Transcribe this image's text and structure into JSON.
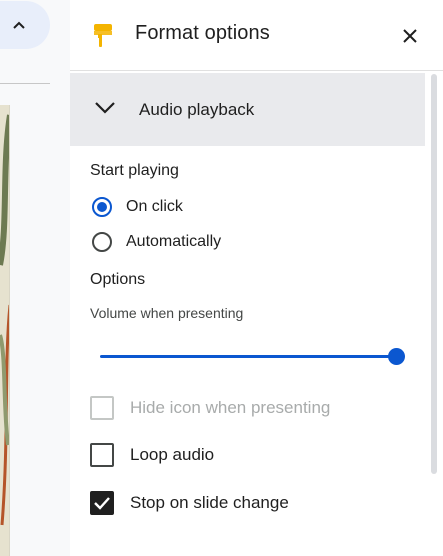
{
  "panel": {
    "title": "Format options",
    "icon": "paint-roller-icon",
    "close_icon": "close-icon"
  },
  "left_strip": {
    "collapse_icon": "chevron-up-icon"
  },
  "section": {
    "title": "Audio playback",
    "expanded": true,
    "icon": "chevron-down-icon"
  },
  "start_playing": {
    "heading": "Start playing",
    "options": [
      {
        "label": "On click",
        "selected": true
      },
      {
        "label": "Automatically",
        "selected": false
      }
    ]
  },
  "options": {
    "heading": "Options",
    "volume_label": "Volume when presenting",
    "volume_level": 1.0,
    "checkboxes": [
      {
        "label": "Hide icon when presenting",
        "checked": false,
        "disabled": true
      },
      {
        "label": "Loop audio",
        "checked": false,
        "disabled": false
      },
      {
        "label": "Stop on slide change",
        "checked": true,
        "disabled": false
      }
    ]
  },
  "colors": {
    "accent": "#0b57d0",
    "section_bg": "#e9eaed",
    "icon_yellow": "#f4b400"
  }
}
